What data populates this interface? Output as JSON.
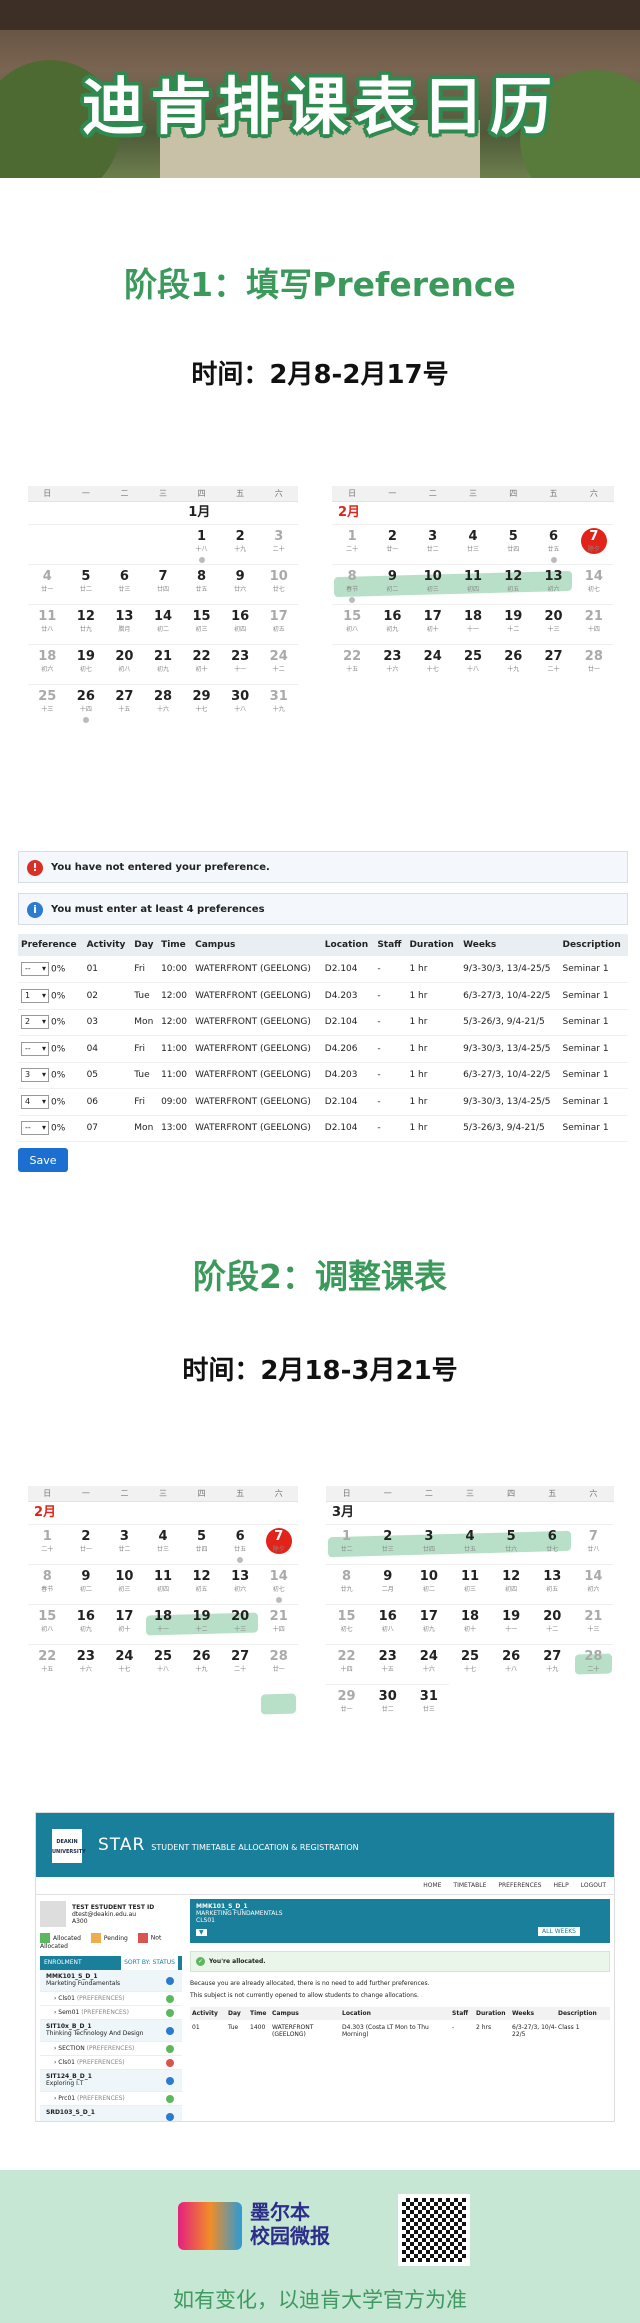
{
  "banner": {
    "title": "迪肯排课表日历"
  },
  "stage1": {
    "title": "阶段1：填写Preference",
    "time": "时间：2月8-2月17号"
  },
  "stage2": {
    "title": "阶段2：调整课表",
    "time": "时间：2月18-3月21号"
  },
  "weekdays": [
    "日",
    "一",
    "二",
    "三",
    "四",
    "五",
    "六"
  ],
  "calendars": {
    "jan": {
      "month": "1月"
    },
    "feb1": {
      "month": "2月"
    },
    "feb2": {
      "month": "2月"
    },
    "mar": {
      "month": "3月"
    }
  },
  "alerts": {
    "error": "You have not entered your preference.",
    "info": "You must enter at least 4 preferences"
  },
  "pref_table": {
    "headers": [
      "Preference",
      "Activity",
      "Day",
      "Time",
      "Campus",
      "Location",
      "Staff",
      "Duration",
      "Weeks",
      "Description"
    ],
    "rows": [
      {
        "pref": "--",
        "pct": "0%",
        "activity": "01",
        "day": "Fri",
        "time": "10:00",
        "campus": "WATERFRONT (GEELONG)",
        "location": "D2.104",
        "staff": "-",
        "duration": "1 hr",
        "weeks": "9/3-30/3, 13/4-25/5",
        "desc": "Seminar 1"
      },
      {
        "pref": "1",
        "pct": "0%",
        "activity": "02",
        "day": "Tue",
        "time": "12:00",
        "campus": "WATERFRONT (GEELONG)",
        "location": "D4.203",
        "staff": "-",
        "duration": "1 hr",
        "weeks": "6/3-27/3, 10/4-22/5",
        "desc": "Seminar 1"
      },
      {
        "pref": "2",
        "pct": "0%",
        "activity": "03",
        "day": "Mon",
        "time": "12:00",
        "campus": "WATERFRONT (GEELONG)",
        "location": "D2.104",
        "staff": "-",
        "duration": "1 hr",
        "weeks": "5/3-26/3, 9/4-21/5",
        "desc": "Seminar 1"
      },
      {
        "pref": "--",
        "pct": "0%",
        "activity": "04",
        "day": "Fri",
        "time": "11:00",
        "campus": "WATERFRONT (GEELONG)",
        "location": "D4.206",
        "staff": "-",
        "duration": "1 hr",
        "weeks": "9/3-30/3, 13/4-25/5",
        "desc": "Seminar 1"
      },
      {
        "pref": "3",
        "pct": "0%",
        "activity": "05",
        "day": "Tue",
        "time": "11:00",
        "campus": "WATERFRONT (GEELONG)",
        "location": "D4.203",
        "staff": "-",
        "duration": "1 hr",
        "weeks": "6/3-27/3, 10/4-22/5",
        "desc": "Seminar 1"
      },
      {
        "pref": "4",
        "pct": "0%",
        "activity": "06",
        "day": "Fri",
        "time": "09:00",
        "campus": "WATERFRONT (GEELONG)",
        "location": "D2.104",
        "staff": "-",
        "duration": "1 hr",
        "weeks": "9/3-30/3, 13/4-25/5",
        "desc": "Seminar 1"
      },
      {
        "pref": "--",
        "pct": "0%",
        "activity": "07",
        "day": "Mon",
        "time": "13:00",
        "campus": "WATERFRONT (GEELONG)",
        "location": "D2.104",
        "staff": "-",
        "duration": "1 hr",
        "weeks": "5/3-26/3, 9/4-21/5",
        "desc": "Seminar 1"
      }
    ],
    "save_label": "Save"
  },
  "star": {
    "logo_text": "DEAKIN UNIVERSITY",
    "brand": "STAR",
    "brand_sub": "STUDENT TIMETABLE ALLOCATION & REGISTRATION",
    "nav": [
      "HOME",
      "TIMETABLE",
      "PREFERENCES",
      "HELP",
      "LOGOUT"
    ],
    "student_name": "TEST ESTUDENT TEST ID",
    "student_email": "dtest@deakin.edu.au",
    "student_code": "A300",
    "legend": {
      "allocated": "Allocated",
      "pending": "Pending",
      "not_allocated": "Not Allocated"
    },
    "enrolment_label": "ENROLMENT",
    "sort_label": "SORT BY: STATUS",
    "units": [
      {
        "code": "MMK101_S_D_1",
        "name": "Marketing Fundamentals"
      },
      {
        "code": "SIT10x_B_D_1",
        "name": "Thinking Technology And Design"
      },
      {
        "code": "SIT124_B_D_1",
        "name": "Exploring I.T"
      },
      {
        "code": "SRD103_S_D_1",
        "name": ""
      }
    ],
    "sub_items": [
      {
        "label": "Cls01",
        "status": "(PREFERENCES)"
      },
      {
        "label": "Sem01",
        "status": "(PREFERENCES)"
      },
      {
        "label": "SECTION",
        "status": "(PREFERENCES)"
      },
      {
        "label": "Cls01",
        "status": "(PREFERENCES)"
      },
      {
        "label": "Prc01",
        "status": "(PREFERENCES)"
      }
    ],
    "panel_title": "MMK101_S_D_1",
    "panel_sub": "MARKETING FUNDAMENTALS",
    "panel_cls": "CLS01",
    "all_weeks": "ALL WEEKS",
    "allocated_msg": "You're allocated.",
    "note1": "Because you are already allocated, there is no need to add further preferences.",
    "note2": "This subject is not currently opened to allow students to change allocations.",
    "alloc_headers": [
      "Activity",
      "Day",
      "Time",
      "Campus",
      "Location",
      "Staff",
      "Duration",
      "Weeks",
      "Description"
    ],
    "alloc_row": {
      "activity": "01",
      "day": "Tue",
      "time": "1400",
      "campus": "WATERFRONT (GEELONG)",
      "location": "D4.303 (Costa LT Mon to Thu Morning)",
      "staff": "-",
      "duration": "2 hrs",
      "weeks": "6/3-27/3, 10/4-22/5",
      "desc": "Class 1"
    }
  },
  "footer": {
    "logo_text": "墨尔本\n校园微报",
    "note": "如有变化，以迪肯大学官方为准"
  },
  "colors": {
    "accent_green": "#3b9a5b",
    "highlight": "#7dc79a",
    "today_red": "#e2231a",
    "star_teal": "#1a7f9a",
    "save_blue": "#1c6fd1"
  }
}
